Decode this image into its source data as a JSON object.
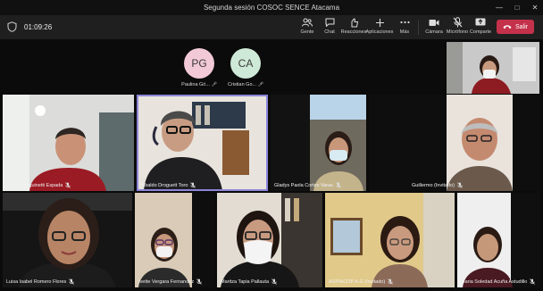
{
  "window": {
    "title": "Segunda sesión COSOC SENCE Atacama",
    "controls": [
      "—",
      "□",
      "✕"
    ]
  },
  "toolbar": {
    "timer": "01:09:26",
    "buttons": [
      {
        "label": "Gente",
        "icon": "people-icon"
      },
      {
        "label": "Chat",
        "icon": "chat-icon"
      },
      {
        "label": "Reacciones",
        "icon": "reactions-icon"
      },
      {
        "label": "Aplicaciones",
        "icon": "add-apps-icon"
      },
      {
        "label": "Más",
        "icon": "more-icon"
      },
      {
        "label": "Cámara",
        "icon": "camera-icon"
      },
      {
        "label": "Micrófono",
        "icon": "mic-off-icon"
      },
      {
        "label": "Comparte",
        "icon": "share-icon"
      }
    ],
    "leave_label": "Salir"
  },
  "avatars": [
    {
      "initials": "PG",
      "name": "Paulina Gó...",
      "color": "#f2c9d6"
    },
    {
      "initials": "CA",
      "name": "Cristian Go...",
      "color": "#cfe9d8"
    }
  ],
  "participants": [
    {
      "name": "Pablo Sanguinetti Espada"
    },
    {
      "name": "Nibaldo Droguett Toro"
    },
    {
      "name": "Gladys Paola Cortes Varas"
    },
    {
      "name": "Guillermo (Invitado)"
    },
    {
      "name": "Luisa Isabel Romero Flores"
    },
    {
      "name": "Ivette Vergara Fernandez"
    },
    {
      "name": "Maritza Tapia Pallauta"
    },
    {
      "name": "ASPIACOP A.G (Invitado)"
    },
    {
      "name": "Maria Soledad Acuña Astudillo"
    }
  ],
  "colors": {
    "accent": "#8b86d9",
    "leave": "#c4314b"
  }
}
